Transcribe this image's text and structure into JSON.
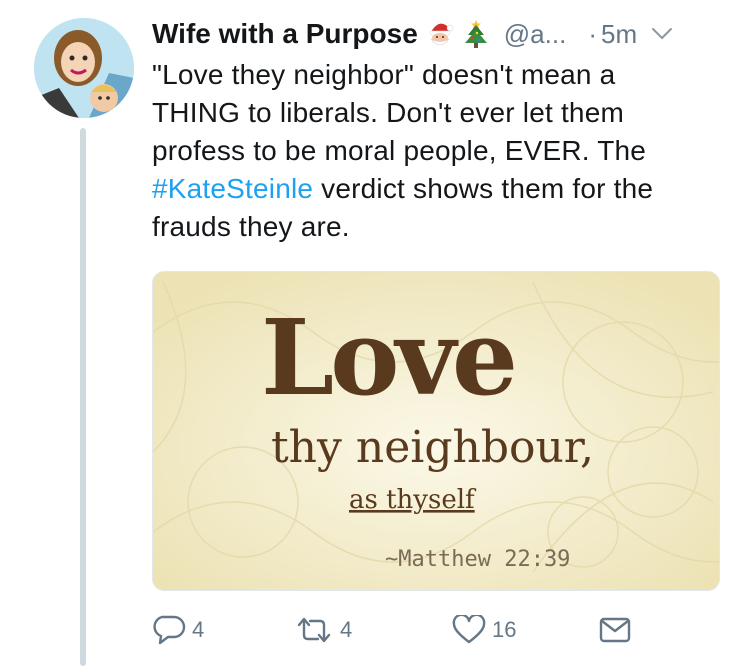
{
  "tweet": {
    "author_name": "Wife with a Purpose",
    "author_emoji": [
      "santa-emoji",
      "christmas-tree-emoji"
    ],
    "handle": "@a...",
    "separator": "·",
    "time": "5m",
    "text_lines": [
      "\"Love they neighbor\" doesn't mean a",
      "THING to liberals. Don't ever let them",
      "profess to be moral people, EVER. The"
    ],
    "hashtag": "#KateSteinle",
    "text_after_hashtag": " verdict shows them for the",
    "text_last_line": "frauds they are."
  },
  "media": {
    "title": "Love",
    "line2": "thy neighbour,",
    "line3": "as thyself",
    "citation": "~Matthew 22:39",
    "colors": {
      "background": "#f6f1d6",
      "ink": "#5a3a1e",
      "citation": "#7b6a55"
    }
  },
  "actions": {
    "reply_count": "4",
    "retweet_count": "4",
    "like_count": "16",
    "icons": [
      "reply-icon",
      "retweet-icon",
      "like-icon",
      "direct-message-icon"
    ]
  },
  "colors": {
    "link": "#1da1f2",
    "secondary_text": "#657786",
    "thread_line": "#cfd9de"
  }
}
